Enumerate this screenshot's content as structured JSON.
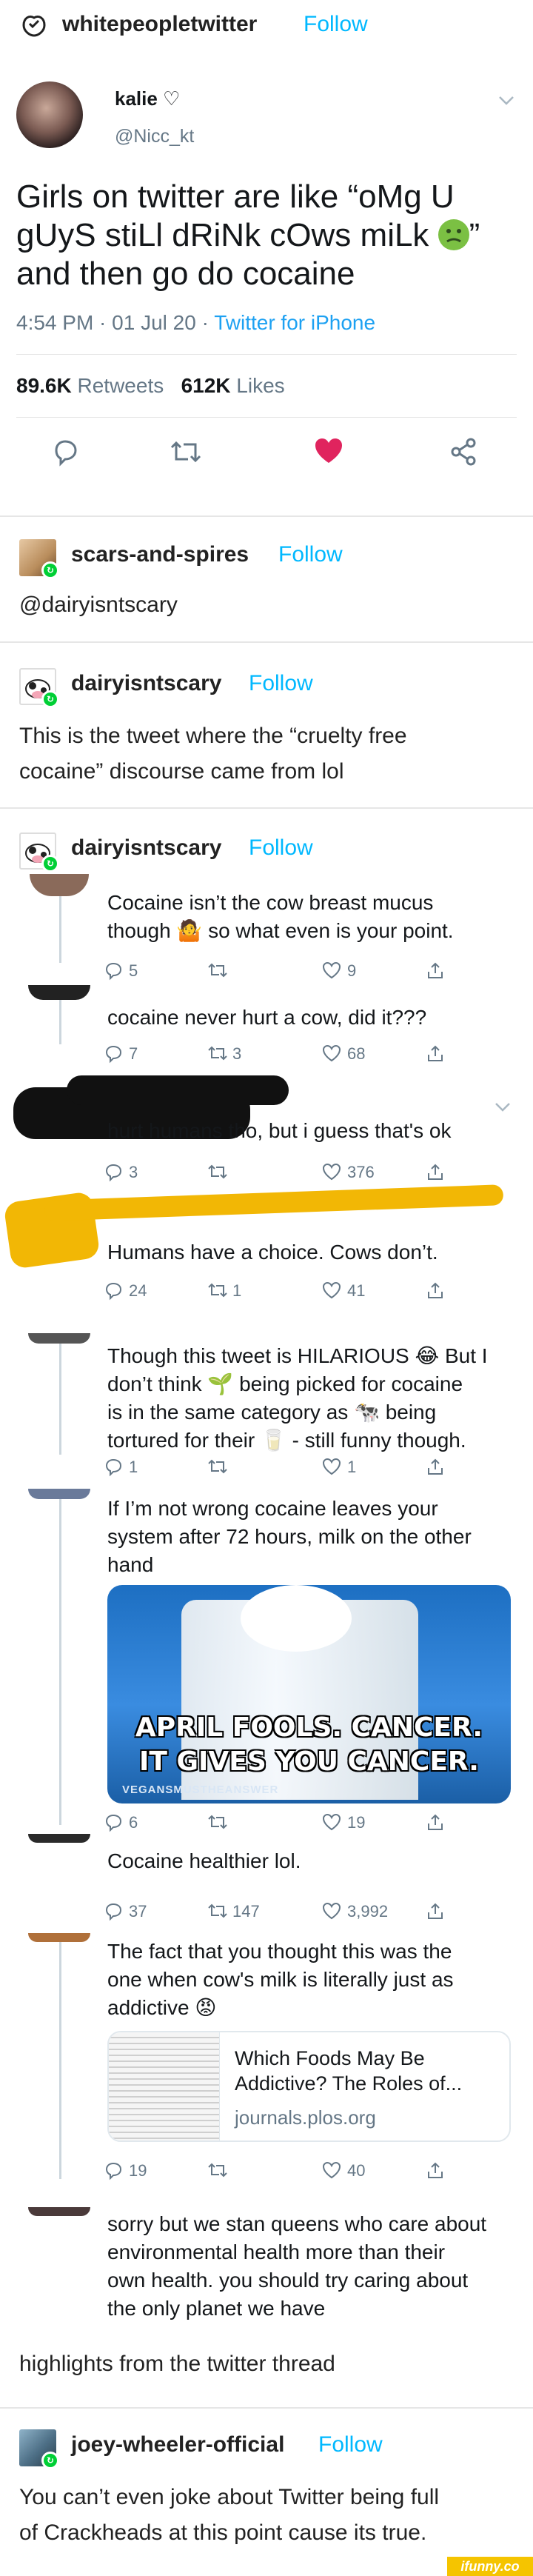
{
  "header": {
    "blog_name": "whitepeopletwitter",
    "follow": "Follow"
  },
  "tweet": {
    "name": "kalie ♡",
    "handle": "@Nicc_kt",
    "text_line1": "Girls on twitter are like “oMg U",
    "text_line2": "gUyS stiLl dRiNk cOws miLk",
    "text_line2_end": "”",
    "text_line3": "and then go do cocaine",
    "time": "4:54 PM · 01 Jul 20 · ",
    "source": "Twitter for iPhone",
    "retweets_count": "89.6K",
    "retweets_label": "Retweets",
    "likes_count": "612K",
    "likes_label": "Likes"
  },
  "reblog1": {
    "blog_name": "scars-and-spires",
    "follow": "Follow",
    "text": "@dairyisntscary"
  },
  "reblog2": {
    "blog_name": "dairyisntscary",
    "follow": "Follow",
    "text_line1": "This is the tweet where the “cruelty free",
    "text_line2": "cocaine” discourse came from lol"
  },
  "reblog3": {
    "blog_name": "dairyisntscary",
    "follow": "Follow"
  },
  "thread": [
    {
      "lines": [
        "Cocaine isn’t the cow breast mucus",
        "though 🤷 so what even is your point."
      ],
      "reply": "5",
      "rt": "",
      "like": "9"
    },
    {
      "lines": [
        "cocaine never hurt a cow, did it???"
      ],
      "reply": "7",
      "rt": "3",
      "like": "68"
    },
    {
      "lines": [
        "hurt humans tho, but i guess that's ok"
      ],
      "reply": "3",
      "rt": "",
      "like": "376"
    },
    {
      "lines": [
        "Humans have a choice. Cows don’t."
      ],
      "reply": "24",
      "rt": "1",
      "like": "41"
    },
    {
      "lines": [
        "Though this tweet is HILARIOUS 😂 But I",
        "don’t think 🌱 being picked for cocaine",
        "is in the same category as 🐄 being",
        "tortured for their 🥛 - still funny though."
      ],
      "reply": "1",
      "rt": "",
      "like": "1"
    },
    {
      "lines": [
        "If I’m not wrong cocaine leaves your",
        "system after 72 hours, milk on the other",
        "hand"
      ],
      "reply": "6",
      "rt": "",
      "like": "19"
    },
    {
      "lines": [
        "Cocaine healthier lol."
      ],
      "reply": "37",
      "rt": "147",
      "like": "3,992"
    },
    {
      "lines": [
        "The fact that you thought this was the",
        "one when cow's milk is literally just as",
        "addictive 😡"
      ],
      "reply": "19",
      "rt": "",
      "like": "40"
    },
    {
      "lines": [
        "sorry but we stan queens who care about",
        "environmental health more than their",
        "own health. you should try caring about",
        "the only planet we have"
      ],
      "reply": "",
      "rt": "",
      "like": ""
    }
  ],
  "milk_image": {
    "caption1": "APRIL FOOLS. CANCER.",
    "caption2": "IT GIVES YOU CANCER.",
    "watermark": "VEGANSMUSTHEANSWER"
  },
  "link_card": {
    "title_line1": "Which Foods May Be",
    "title_line2": "Addictive? The Roles of...",
    "domain": "journals.plos.org"
  },
  "reblog3_caption": "highlights from the twitter thread",
  "reblog4": {
    "blog_name": "joey-wheeler-official",
    "follow": "Follow",
    "text_line1": "You can’t even joke about Twitter being full",
    "text_line2": "of Crackheads at this point cause its true."
  },
  "watermark": "ifunny.co",
  "colors": {
    "follow": "#00b8ff",
    "twitter_blue": "#1da1f2",
    "heart": "#e0245e",
    "reblog_green": "#00cf35"
  }
}
